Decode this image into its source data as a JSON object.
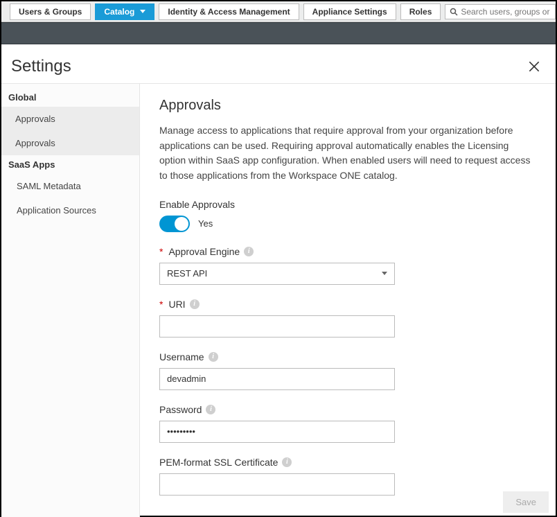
{
  "topnav": {
    "tabs": [
      {
        "label": "Users & Groups"
      },
      {
        "label": "Catalog"
      },
      {
        "label": "Identity & Access Management"
      },
      {
        "label": "Appliance Settings"
      },
      {
        "label": "Roles"
      }
    ],
    "search_placeholder": "Search users, groups or applications"
  },
  "page_title": "Settings",
  "sidebar": {
    "section_global": "Global",
    "item_approvals_1": "Approvals",
    "item_approvals_2": "Approvals",
    "section_saas": "SaaS Apps",
    "item_saml": "SAML Metadata",
    "item_appsources": "Application Sources"
  },
  "main": {
    "heading": "Approvals",
    "description": "Manage access to applications that require approval from your organization before applications can be used. Requiring approval automatically enables the Licensing option within SaaS app configuration. When enabled users will need to request access to those applications from the Workspace ONE catalog.",
    "enable_label": "Enable Approvals",
    "toggle_state": "Yes",
    "engine_label": "Approval Engine",
    "engine_value": "REST API",
    "uri_label": "URI",
    "uri_value": "",
    "username_label": "Username",
    "username_value": "devadmin",
    "password_label": "Password",
    "password_value": "•••••••••",
    "pem_label": "PEM-format SSL Certificate",
    "pem_value": "",
    "save_label": "Save"
  }
}
